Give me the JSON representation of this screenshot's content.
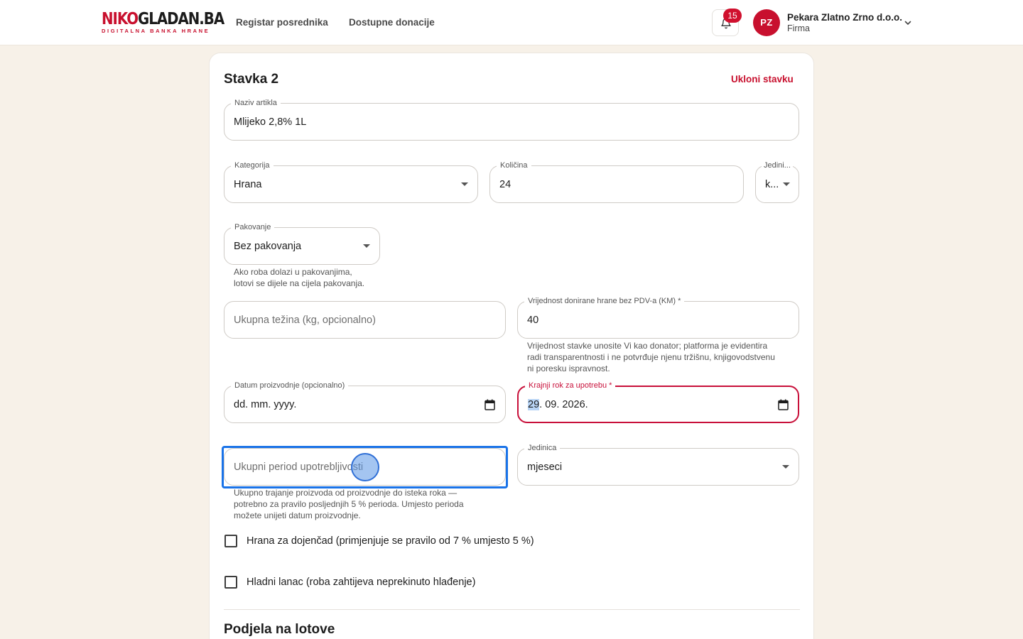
{
  "header": {
    "logo_part1": "NIKO",
    "logo_part2": "GLADAN.BA",
    "logo_tagline": "DIGITALNA BANKA HRANE",
    "nav": [
      "Registar posrednika",
      "Dostupne donacije"
    ],
    "notifications_count": "15",
    "user": {
      "initials": "PZ",
      "name": "Pekara Zlatno Zrno d.o.o.",
      "role": "Firma"
    }
  },
  "item": {
    "title": "Stavka 2",
    "remove_label": "Ukloni stavku",
    "naziv": {
      "label": "Naziv artikla",
      "value": "Mlijeko 2,8% 1L"
    },
    "kategorija": {
      "label": "Kategorija",
      "value": "Hrana"
    },
    "kolicina": {
      "label": "Količina",
      "value": "24"
    },
    "jedinica_kol": {
      "label": "Jedini...",
      "value": "k..."
    },
    "pakovanje": {
      "label": "Pakovanje",
      "value": "Bez pakovanja",
      "helper_line1": "Ako roba dolazi u pakovanjima,",
      "helper_line2": "lotovi se dijele na cijela pakovanja."
    },
    "tezina": {
      "placeholder": "Ukupna težina (kg, opcionalno)"
    },
    "vrijednost": {
      "label": "Vrijednost donirane hrane bez PDV-a (KM) *",
      "value": "40",
      "helper_line1": "Vrijednost stavke unosite Vi kao donator; platforma je evidentira",
      "helper_line2": "radi transparentnosti i ne potvrđuje njenu tržišnu, knjigovodstvenu",
      "helper_line3": "ni poresku ispravnost."
    },
    "datum_proizvodnje": {
      "label": "Datum proizvodnje (opcionalno)",
      "value": "dd. mm. yyyy."
    },
    "rok": {
      "label": "Krajnji rok za upotrebu *",
      "day": "29",
      "rest": ". 09. 2026."
    },
    "period": {
      "placeholder": "Ukupni period upotrebljivosti",
      "helper_line1": "Ukupno trajanje proizvoda od proizvodnje do isteka roka —",
      "helper_line2": "potrebno za pravilo posljednjih 5 % perioda. Umjesto perioda",
      "helper_line3": "možete unijeti datum proizvodnje."
    },
    "period_jedinica": {
      "label": "Jedinica",
      "value": "mjeseci"
    },
    "checkbox_dojencad": "Hrana za dojenčad (primjenjuje se pravilo od 7 % umjesto 5 %)",
    "checkbox_hladni": "Hladni lanac (roba zahtijeva neprekinuto hlađenje)"
  },
  "lotovi": {
    "title": "Podjela na lotove"
  },
  "colors": {
    "brand": "#c8102e",
    "focus": "#1a73e8",
    "background": "#f7f1e8"
  },
  "icons": [
    "bell-icon",
    "chevron-down-icon",
    "calendar-icon",
    "dropdown-caret-icon"
  ]
}
